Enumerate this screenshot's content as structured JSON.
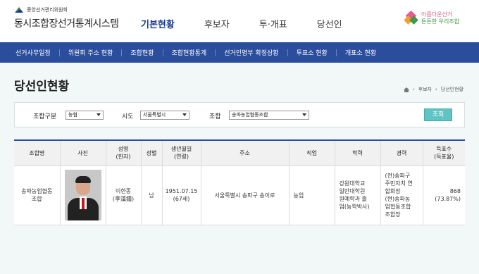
{
  "header": {
    "org_name": "중앙선거관리위원회",
    "system_title": "동시조합장선거통계시스템",
    "nav": [
      {
        "label": "기본현황",
        "active": true
      },
      {
        "label": "후보자",
        "active": false
      },
      {
        "label": "투·개표",
        "active": false
      },
      {
        "label": "당선인",
        "active": false
      }
    ],
    "slogan_line1": "아름다운선거",
    "slogan_line2": "튼튼한 우리조합"
  },
  "subnav": {
    "items": [
      "선거사무일정",
      "위원회 주소 현황",
      "조합현황",
      "조합현황통계",
      "선거인명부 확정상황",
      "투표소 현황",
      "개표소 현황"
    ]
  },
  "page": {
    "title": "당선인현황",
    "breadcrumb": [
      "후보자",
      "당선인현황"
    ]
  },
  "search": {
    "type_label": "조합구분",
    "type_value": "농협",
    "region_label": "시도",
    "region_value": "서울특별시",
    "union_label": "조합",
    "union_value": "송파농업협동조합",
    "submit_label": "조회"
  },
  "table": {
    "headers": {
      "union": "조합명",
      "photo": "사진",
      "name": "성명\n(한자)",
      "gender": "성별",
      "birth": "생년월일\n(연령)",
      "address": "주소",
      "job": "직업",
      "education": "학력",
      "career": "경력",
      "votes": "득표수\n(득표율)"
    },
    "rows": [
      {
        "union": "송파농업협동\n조합",
        "name": "이한종\n(李漢鍾)",
        "gender": "남",
        "birth": "1951.07.15\n(67세)",
        "address": "서울특별시 송파구 송이로",
        "job": "농업",
        "education": "강원대학교\n일반대학원\n원예학과 졸\n업(농학박사)",
        "career": "(전)송파구\n주민자치 연\n합회장\n(현)송파농\n업협동조합\n조합장",
        "votes": "868\n(73.87%)"
      }
    ]
  }
}
